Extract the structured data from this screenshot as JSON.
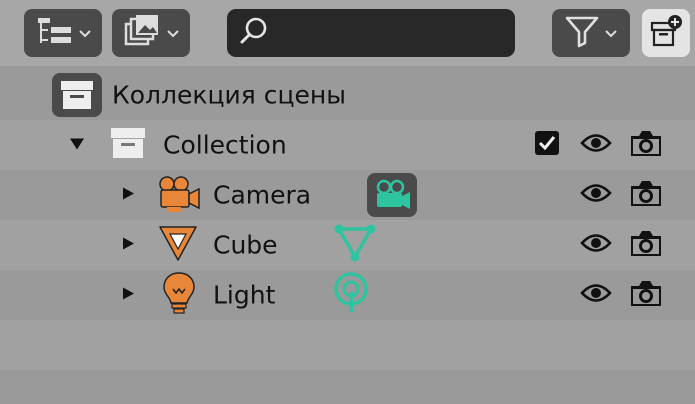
{
  "header": {
    "display_mode_icon": "outliner-tree-icon",
    "filter_mode_icon": "image-gallery-icon",
    "search": {
      "value": "",
      "placeholder": ""
    },
    "filter_icon": "funnel-icon",
    "new_collection_icon": "new-collection-icon"
  },
  "tree": {
    "scene_collection": {
      "label": "Коллекция сцены"
    },
    "collection": {
      "label": "Collection",
      "checked": true
    },
    "objects": [
      {
        "label": "Camera",
        "type_icon": "camera-object-icon",
        "data_icon": "camera-data-icon",
        "data_selected": true
      },
      {
        "label": "Cube",
        "type_icon": "mesh-object-icon",
        "data_icon": "mesh-data-icon",
        "data_selected": false
      },
      {
        "label": "Light",
        "type_icon": "light-object-icon",
        "data_icon": "light-data-icon",
        "data_selected": false
      }
    ]
  },
  "colors": {
    "object_orange": "#e8873a",
    "data_teal": "#2fc4a0",
    "header_bg": "#a7a7a7",
    "row_even": "#a1a1a1",
    "row_odd": "#9a9a9a"
  }
}
